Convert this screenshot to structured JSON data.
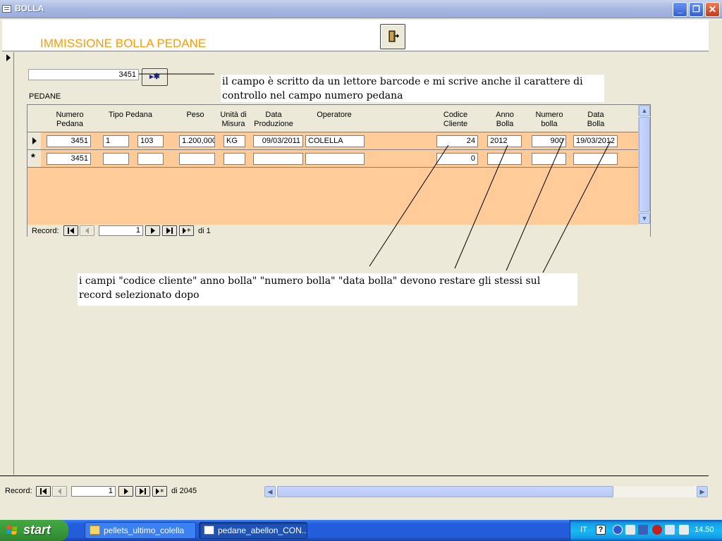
{
  "window": {
    "title": "BOLLA"
  },
  "header": {
    "form_title": "IMMISSIONE BOLLA PEDANE"
  },
  "barcode": {
    "value": "3451",
    "new_button_label": "▸✱"
  },
  "notes": {
    "top": "il campo è scritto da un lettore barcode e mi scrive anche il carattere di controllo nel campo numero pedana",
    "bottom": "i campi \"codice cliente\" anno bolla\" \"numero bolla\" \"data bolla\" devono restare gli stessi sul record selezionato dopo"
  },
  "subform": {
    "label": "PEDANE",
    "columns": {
      "numero_pedana": "Numero Pedana",
      "tipo_pedana": "Tipo Pedana",
      "peso": "Peso",
      "unita_misura": "Unità di Misura",
      "data_produzione": "Data Produzione",
      "operatore": "Operatore",
      "codice_cliente": "Codice Cliente",
      "anno_bolla": "Anno Bolla",
      "numero_bolla": "Numero bolla",
      "data_bolla": "Data Bolla"
    },
    "rows": [
      {
        "numero_pedana": "3451",
        "tipo1": "1",
        "tipo2": "103",
        "peso": "1.200,000",
        "um": "KG",
        "data_produzione": "09/03/2011",
        "operatore": "COLELLA",
        "codice_cliente": "24",
        "anno_bolla": "2012",
        "numero_bolla": "900",
        "data_bolla": "19/03/2012"
      },
      {
        "numero_pedana": "3451",
        "tipo1": "",
        "tipo2": "",
        "peso": "",
        "um": "",
        "data_produzione": "",
        "operatore": "",
        "codice_cliente": "0",
        "anno_bolla": "",
        "numero_bolla": "",
        "data_bolla": ""
      }
    ],
    "nav": {
      "label": "Record:",
      "current": "1",
      "of": "di 1"
    }
  },
  "main_nav": {
    "label": "Record:",
    "current": "1",
    "of": "di 2045"
  },
  "taskbar": {
    "start": "start",
    "tasks": [
      "pellets_ultimo_colella",
      "pedane_abellon_CON..."
    ],
    "lang": "IT",
    "clock": "14.50"
  },
  "colors": {
    "form_title": "#ff9900",
    "row_bg": "#ffcc99"
  }
}
